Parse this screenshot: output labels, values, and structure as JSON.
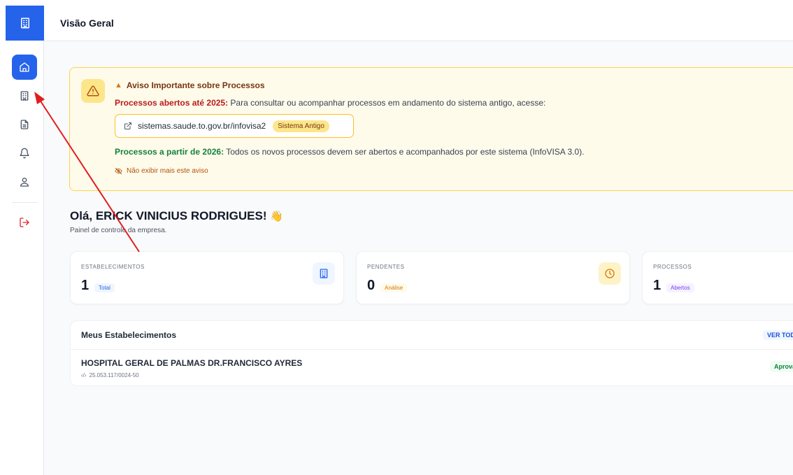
{
  "sidebar": {
    "logo_icon": "building-icon",
    "items": [
      {
        "name": "home",
        "icon": "home-icon",
        "active": true
      },
      {
        "name": "establishments",
        "icon": "building-icon",
        "active": false
      },
      {
        "name": "documents",
        "icon": "document-icon",
        "active": false
      },
      {
        "name": "notifications",
        "icon": "bell-icon",
        "active": false
      },
      {
        "name": "profile",
        "icon": "user-icon",
        "active": false
      }
    ],
    "logout_icon": "logout-icon"
  },
  "header": {
    "title": "Visão Geral"
  },
  "alert": {
    "title": "Aviso Importante sobre Processos",
    "line1_strong": "Processos abertos até 2025:",
    "line1_text": " Para consultar ou acompanhar processos em andamento do sistema antigo, acesse:",
    "link_text": "sistemas.saude.to.gov.br/infovisa2",
    "link_badge": "Sistema Antigo",
    "line2_strong": "Processos a partir de 2026:",
    "line2_text": " Todos os novos processos devem ser abertos e acompanhados por este sistema (InfoVISA 3.0).",
    "dismiss_label": "Não exibir mais este aviso"
  },
  "greeting": {
    "title": "Olá, ERICK VINICIUS RODRIGUES!",
    "emoji": "👋",
    "subtitle": "Painel de controle da empresa."
  },
  "stats": [
    {
      "label": "ESTABELECIMENTOS",
      "value": "1",
      "tag": "Total",
      "icon": "building-icon",
      "color": "#2563eb"
    },
    {
      "label": "PENDENTES",
      "value": "0",
      "tag": "Análise",
      "icon": "clock-icon",
      "color": "#d97706"
    },
    {
      "label": "PROCESSOS",
      "value": "1",
      "tag": "Abertos",
      "icon": "",
      "color": "#7c3aed"
    }
  ],
  "establishments": {
    "title": "Meus Estabelecimentos",
    "view_all": "VER TODOS",
    "rows": [
      {
        "name": "HOSPITAL GERAL DE PALMAS DR.FRANCISCO AYRES",
        "cnpj": "25.053.117/0024-50",
        "status": "Aprovado"
      }
    ]
  },
  "colors": {
    "primary": "#2563eb",
    "warning_bg": "#fffbeb",
    "warning_border": "#fcd34d",
    "logout": "#dc2626",
    "arrow": "#e11d1d"
  }
}
